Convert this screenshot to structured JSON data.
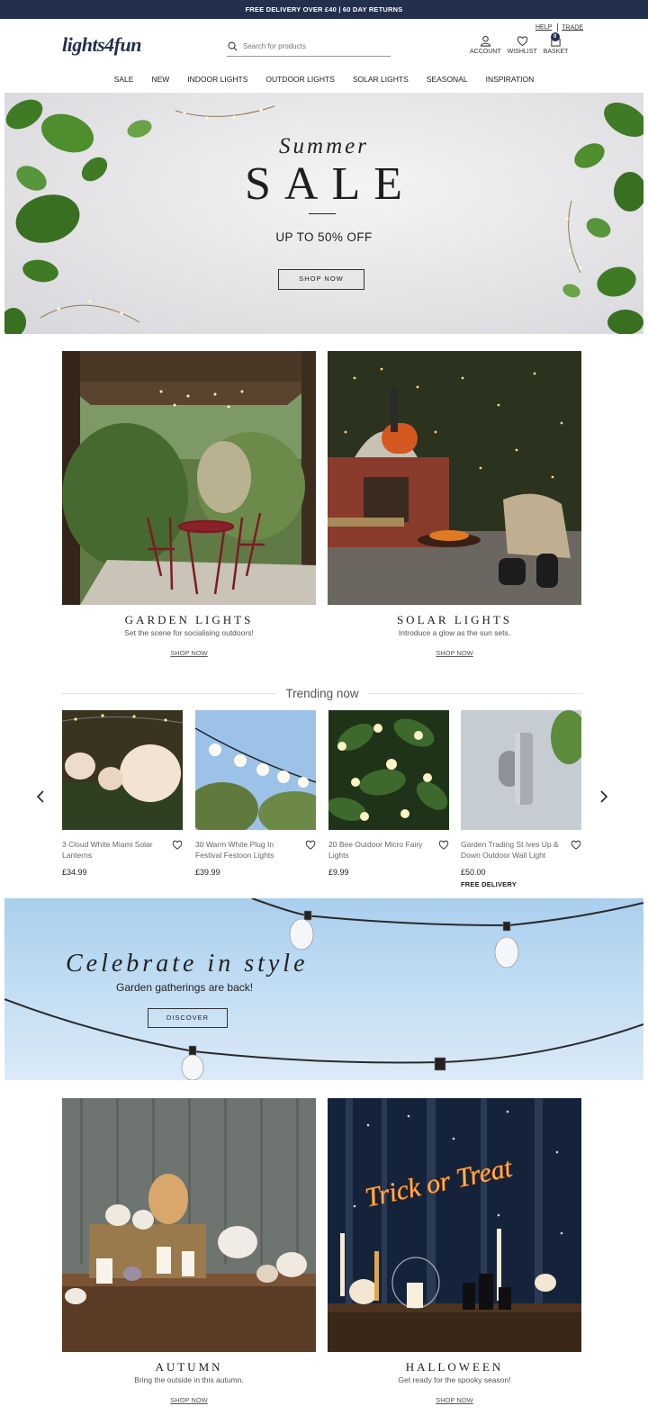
{
  "topbar": {
    "text": "FREE DELIVERY OVER £40  |  60 DAY RETURNS"
  },
  "header": {
    "logo": "lights4fun",
    "search_placeholder": "Search for products",
    "help": "HELP",
    "trade": "TRADE",
    "account": "ACCOUNT",
    "wishlist": "WISHLIST",
    "basket": "BASKET",
    "basket_count": "0"
  },
  "nav": [
    "SALE",
    "NEW",
    "INDOOR LIGHTS",
    "OUTDOOR LIGHTS",
    "SOLAR LIGHTS",
    "SEASONAL",
    "INSPIRATION"
  ],
  "hero": {
    "script": "Summer",
    "title": "SALE",
    "subtitle": "UP TO 50% OFF",
    "button": "SHOP NOW"
  },
  "categories_top": [
    {
      "title": "GARDEN LIGHTS",
      "subtitle": "Set the scene for socialising outdoors!",
      "link": "SHOP NOW"
    },
    {
      "title": "SOLAR LIGHTS",
      "subtitle": "Introduce a glow as the sun sets.",
      "link": "SHOP NOW"
    }
  ],
  "trending": {
    "heading": "Trending now",
    "products": [
      {
        "name": "3 Cloud White Miami Solar Lanterns",
        "price": "£34.99",
        "extra": ""
      },
      {
        "name": "30 Warm White Plug In Festival Festoon Lights",
        "price": "£39.99",
        "extra": ""
      },
      {
        "name": "20 Bee Outdoor Micro Fairy Lights",
        "price": "£9.99",
        "extra": ""
      },
      {
        "name": "Garden Trading St Ives Up & Down Outdoor Wall Light",
        "price": "£50.00",
        "extra": "FREE DELIVERY"
      }
    ]
  },
  "banner2": {
    "title": "Celebrate in style",
    "subtitle": "Garden gatherings are back!",
    "button": "DISCOVER"
  },
  "categories_bottom": [
    {
      "title": "AUTUMN",
      "subtitle": "Bring the outside in this autumn.",
      "link": "SHOP NOW"
    },
    {
      "title": "HALLOWEEN",
      "subtitle": "Get ready for the spooky season!",
      "link": "SHOP NOW",
      "neon": "Trick or Treat"
    }
  ]
}
